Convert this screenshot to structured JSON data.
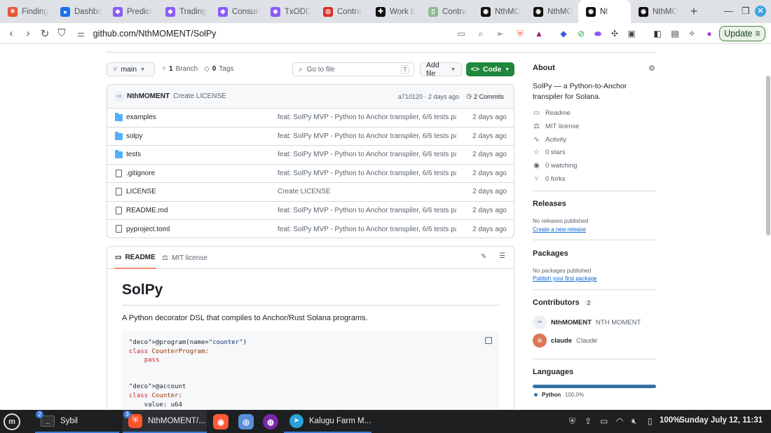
{
  "browser": {
    "tabs": [
      {
        "title": "Finding",
        "color": "#e8543b",
        "glyph": "✳"
      },
      {
        "title": "Dashbo",
        "color": "#1a73e8",
        "glyph": "●"
      },
      {
        "title": "Predict",
        "color": "#8b5cf6",
        "glyph": "◆"
      },
      {
        "title": "Trading",
        "color": "#8b5cf6",
        "glyph": "◆"
      },
      {
        "title": "Consun",
        "color": "#8b5cf6",
        "glyph": "◆"
      },
      {
        "title": "TxODD",
        "color": "#8b5cf6",
        "glyph": "◆"
      },
      {
        "title": "Contra",
        "color": "#d93025",
        "glyph": "◎"
      },
      {
        "title": "Work b",
        "color": "#111111",
        "glyph": "✚"
      },
      {
        "title": "Contra",
        "color": "#8fbc8f",
        "glyph": "▯"
      },
      {
        "title": "NthMO",
        "color": "#111111",
        "glyph": "◉"
      },
      {
        "title": "NthMO",
        "color": "#111111",
        "glyph": "◉"
      },
      {
        "title": "Nt",
        "color": "#111111",
        "glyph": "◉"
      },
      {
        "title": "NthMO",
        "color": "#111111",
        "glyph": "◉"
      }
    ],
    "new_tab": "+",
    "url": "github.com/NthMOMENT/SolPy",
    "update_label": "Update"
  },
  "repo": {
    "branch": "main",
    "branches_count": "1",
    "branches_label": "Branch",
    "tags_count": "0",
    "tags_label": "Tags",
    "go_to_file_placeholder": "Go to file",
    "go_to_file_key": "T",
    "add_file_label": "Add file",
    "code_label": "Code",
    "latest_commit": {
      "author": "NthMOMENT",
      "message": "Create LICENSE",
      "sha_time": "a710120 · 2 days ago",
      "commits": "2 Commits"
    },
    "files": [
      {
        "name": "examples",
        "type": "folder",
        "message": "feat: SolPy MVP - Python to Anchor transpiler, 6/6 tests pa...",
        "date": "2 days ago"
      },
      {
        "name": "solpy",
        "type": "folder",
        "message": "feat: SolPy MVP - Python to Anchor transpiler, 6/6 tests pa...",
        "date": "2 days ago"
      },
      {
        "name": "tests",
        "type": "folder",
        "message": "feat: SolPy MVP - Python to Anchor transpiler, 6/6 tests pa...",
        "date": "2 days ago"
      },
      {
        "name": ".gitignore",
        "type": "file",
        "message": "feat: SolPy MVP - Python to Anchor transpiler, 6/6 tests pa...",
        "date": "2 days ago"
      },
      {
        "name": "LICENSE",
        "type": "file",
        "message": "Create LICENSE",
        "date": "2 days ago"
      },
      {
        "name": "README.md",
        "type": "file",
        "message": "feat: SolPy MVP - Python to Anchor transpiler, 6/6 tests pa...",
        "date": "2 days ago"
      },
      {
        "name": "pyproject.toml",
        "type": "file",
        "message": "feat: SolPy MVP - Python to Anchor transpiler, 6/6 tests pa...",
        "date": "2 days ago"
      }
    ]
  },
  "readme": {
    "tab_readme": "README",
    "tab_license": "MIT license",
    "title": "SolPy",
    "description": "A Python decorator DSL that compiles to Anchor/Rust Solana programs.",
    "code_lines": [
      "@program(name=\"counter\")",
      "class CounterProgram:",
      "    pass",
      "",
      "",
      "@account",
      "class Counter:",
      "    value: u64"
    ]
  },
  "sidebar": {
    "about_title": "About",
    "about_text": "SolPy — a Python-to-Anchor transpiler for Solana.",
    "meta": [
      {
        "icon": "book-icon",
        "glyph": "▭",
        "label": "Readme"
      },
      {
        "icon": "scale-icon",
        "glyph": "⚖",
        "label": "MIT license"
      },
      {
        "icon": "pulse-icon",
        "glyph": "∿",
        "label": "Activity"
      },
      {
        "icon": "star-icon",
        "glyph": "☆",
        "label": "0 stars"
      },
      {
        "icon": "eye-icon",
        "glyph": "◉",
        "label": "0 watching"
      },
      {
        "icon": "fork-icon",
        "glyph": "⑂",
        "label": "0 forks"
      }
    ],
    "releases_title": "Releases",
    "releases_none": "No releases published",
    "releases_link": "Create a new release",
    "packages_title": "Packages",
    "packages_none": "No packages published",
    "packages_link": "Publish your first package",
    "contributors_title": "Contributors",
    "contributors_count": "2",
    "contributors": [
      {
        "login": "NthMOMENT",
        "name": "NTH MOMENT",
        "avatar_color": "#eef0f7"
      },
      {
        "login": "claude",
        "name": "Claude",
        "avatar_color": "#d97757"
      }
    ],
    "languages_title": "Languages",
    "language": {
      "name": "Python",
      "percent": "100.0%",
      "color": "#3572A5",
      "fraction": 1.0
    }
  },
  "taskbar": {
    "apps": [
      {
        "label": "Sybil",
        "badge": "2"
      },
      {
        "label": "NthMOMENT/...",
        "badge": "3"
      },
      {
        "label": "Kalugu Farm M...",
        "badge": ""
      }
    ],
    "battery": "100%",
    "clock": "Sunday July 12, 11:31"
  }
}
